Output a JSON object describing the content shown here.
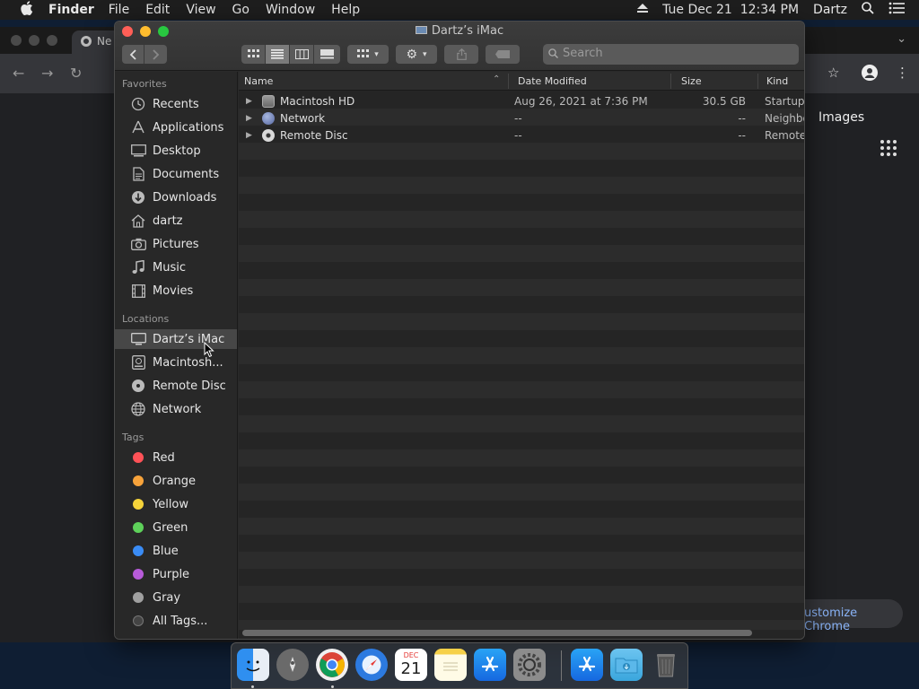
{
  "menubar": {
    "app_name": "Finder",
    "items": [
      "File",
      "Edit",
      "View",
      "Go",
      "Window",
      "Help"
    ],
    "datetime": "Tue Dec 21  12:34 PM",
    "user": "Dartz"
  },
  "chrome": {
    "tab_title": "Ne",
    "images_link": "Images",
    "customize_label": "ustomize Chrome"
  },
  "finder": {
    "title": "Dartz’s iMac",
    "search_placeholder": "Search",
    "sidebar": {
      "favorites_header": "Favorites",
      "favorites": [
        {
          "label": "Recents",
          "icon": "clock-icon"
        },
        {
          "label": "Applications",
          "icon": "applications-icon"
        },
        {
          "label": "Desktop",
          "icon": "desktop-icon"
        },
        {
          "label": "Documents",
          "icon": "document-icon"
        },
        {
          "label": "Downloads",
          "icon": "download-icon"
        },
        {
          "label": "dartz",
          "icon": "home-icon"
        },
        {
          "label": "Pictures",
          "icon": "camera-icon"
        },
        {
          "label": "Music",
          "icon": "music-note-icon"
        },
        {
          "label": "Movies",
          "icon": "film-icon"
        }
      ],
      "locations_header": "Locations",
      "locations": [
        {
          "label": "Dartz’s iMac",
          "icon": "computer-icon",
          "selected": true
        },
        {
          "label": "Macintosh...",
          "icon": "hard-drive-icon"
        },
        {
          "label": "Remote Disc",
          "icon": "disc-icon"
        },
        {
          "label": "Network",
          "icon": "network-globe-icon"
        }
      ],
      "tags_header": "Tags",
      "tags": [
        {
          "label": "Red",
          "color": "#ff5257"
        },
        {
          "label": "Orange",
          "color": "#f7a33b"
        },
        {
          "label": "Yellow",
          "color": "#f5d33a"
        },
        {
          "label": "Green",
          "color": "#5ed15a"
        },
        {
          "label": "Blue",
          "color": "#3a8cf5"
        },
        {
          "label": "Purple",
          "color": "#b75bd9"
        },
        {
          "label": "Gray",
          "color": "#a0a0a0"
        },
        {
          "label": "All Tags...",
          "color": "#555555"
        }
      ]
    },
    "columns": {
      "name": "Name",
      "date": "Date Modified",
      "size": "Size",
      "kind": "Kind"
    },
    "rows": [
      {
        "name": "Macintosh HD",
        "date": "Aug 26, 2021 at 7:36 PM",
        "size": "30.5 GB",
        "kind": "Startup",
        "icon": "hard-drive-icon"
      },
      {
        "name": "Network",
        "date": "--",
        "size": "--",
        "kind": "Neighbo",
        "icon": "network-globe-icon"
      },
      {
        "name": "Remote Disc",
        "date": "--",
        "size": "--",
        "kind": "Remote",
        "icon": "disc-icon"
      }
    ]
  },
  "dock": {
    "calendar_month": "DEC",
    "calendar_day": "21"
  }
}
